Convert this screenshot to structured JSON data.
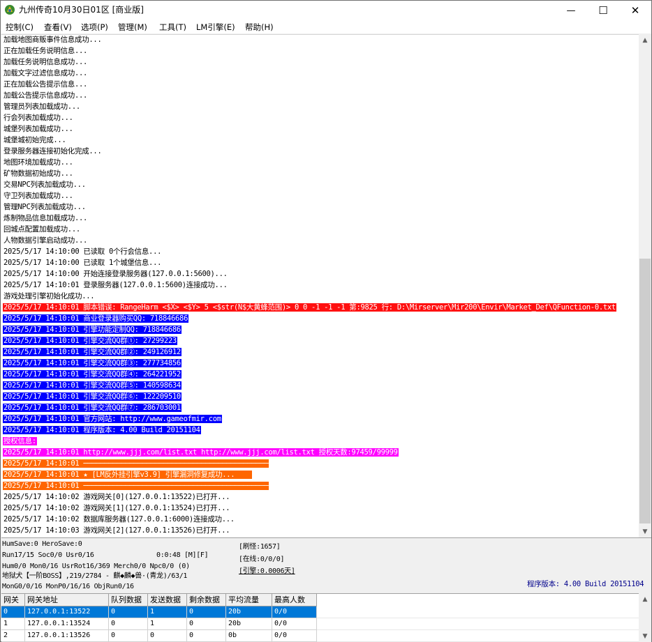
{
  "window": {
    "title": "九州传奇10月30日01区 [商业版]",
    "minimize_glyph": "—",
    "maximize_glyph": "☐",
    "close_glyph": "✕"
  },
  "menu": [
    "控制(C)",
    "查看(V)",
    "选项(P)",
    "管理(M)",
    "工具(T)",
    "LM引擎(E)",
    "帮助(H)"
  ],
  "log_lines": [
    {
      "text": "加载地图商贩事件信息成功...",
      "style": "plain"
    },
    {
      "text": "正在加载任务说明信息...",
      "style": "plain"
    },
    {
      "text": "加载任务说明信息成功...",
      "style": "plain"
    },
    {
      "text": "加载文字过滤信息成功...",
      "style": "plain"
    },
    {
      "text": "正在加载公告提示信息...",
      "style": "plain"
    },
    {
      "text": "加载公告提示信息成功...",
      "style": "plain"
    },
    {
      "text": "管理员列表加载成功...",
      "style": "plain"
    },
    {
      "text": "行会列表加载成功...",
      "style": "plain"
    },
    {
      "text": "城堡列表加载成功...",
      "style": "plain"
    },
    {
      "text": "城堡城初始完成...",
      "style": "plain"
    },
    {
      "text": "登录服务器连接初始化完成...",
      "style": "plain"
    },
    {
      "text": "地图环境加载成功...",
      "style": "plain"
    },
    {
      "text": "矿物数据初始成功...",
      "style": "plain"
    },
    {
      "text": "交易NPC列表加载成功...",
      "style": "plain"
    },
    {
      "text": "守卫列表加载成功...",
      "style": "plain"
    },
    {
      "text": "管理NPC列表加载成功...",
      "style": "plain"
    },
    {
      "text": "炼制物品信息加载成功...",
      "style": "plain"
    },
    {
      "text": "回城点配置加载成功...",
      "style": "plain"
    },
    {
      "text": "人物数据引擎启动成功...",
      "style": "plain"
    },
    {
      "text": "2025/5/17 14:10:00 已读取 0个行会信息...",
      "style": "plain"
    },
    {
      "text": "2025/5/17 14:10:00 已读取 1个城堡信息...",
      "style": "plain"
    },
    {
      "text": "2025/5/17 14:10:00 开始连接登录服务器(127.0.0.1:5600)...",
      "style": "plain"
    },
    {
      "text": "2025/5/17 14:10:01 登录服务器(127.0.0.1:5600)连接成功...",
      "style": "plain"
    },
    {
      "text": "游戏处理引擎初始化成功...",
      "style": "plain"
    },
    {
      "text": "2025/5/17 14:10:01 脚本错误: RangeHarm <$X> <$Y> 5 <$str(N$大黄蜂范围)> 0 0 -1 -1 -1 第:9825 行: D:\\Mirserver\\Mir200\\Envir\\Market_Def\\QFunction-0.txt",
      "style": "red"
    },
    {
      "text": "2025/5/17 14:10:01 商业登录器购买QQ: 718846686",
      "style": "blue"
    },
    {
      "text": "2025/5/17 14:10:01 引擎功能定制QQ: 718846686",
      "style": "blue"
    },
    {
      "text": "2025/5/17 14:10:01 引擎交流QQ群①: 27299223",
      "style": "blue"
    },
    {
      "text": "2025/5/17 14:10:01 引擎交流QQ群②: 249126912",
      "style": "blue"
    },
    {
      "text": "2025/5/17 14:10:01 引擎交流QQ群③: 277734856",
      "style": "blue"
    },
    {
      "text": "2025/5/17 14:10:01 引擎交流QQ群④: 264221952",
      "style": "blue"
    },
    {
      "text": "2025/5/17 14:10:01 引擎交流QQ群⑤: 140598634",
      "style": "blue"
    },
    {
      "text": "2025/5/17 14:10:01 引擎交流QQ群⑥: 122209510",
      "style": "blue"
    },
    {
      "text": "2025/5/17 14:10:01 引擎交流QQ群⑦: 286703001",
      "style": "blue"
    },
    {
      "text": "2025/5/17 14:10:01 官方网站: http://www.gameofmir.com",
      "style": "blue"
    },
    {
      "text": "2025/5/17 14:10:01 程序版本: 4.00 Build 20151104",
      "style": "blue"
    },
    {
      "text": "授权信息:",
      "style": "magenta"
    },
    {
      "text": "2025/5/17 14:10:01 http://www.jjj.com/list.txt http://www.jjj.com/list.txt 授权天数:97459/99999",
      "style": "magenta"
    },
    {
      "text": "2025/5/17 14:10:01 ────────────────────────────────────────────",
      "style": "orange"
    },
    {
      "text": "2025/5/17 14:10:01 ★ [LM反外挂引擎v3.9] 引擎漏洞修复成功...    ",
      "style": "orange"
    },
    {
      "text": "2025/5/17 14:10:01 ────────────────────────────────────────────",
      "style": "orange"
    },
    {
      "text": "2025/5/17 14:10:02 游戏网关[0](127.0.0.1:13522)已打开...",
      "style": "plain"
    },
    {
      "text": "2025/5/17 14:10:02 游戏网关[1](127.0.0.1:13524)已打开...",
      "style": "plain"
    },
    {
      "text": "2025/5/17 14:10:02 数据库服务器(127.0.0.1:6000)连接成功...",
      "style": "plain"
    },
    {
      "text": "2025/5/17 14:10:03 游戏网关[2](127.0.0.1:13526)已打开...",
      "style": "plain"
    }
  ],
  "log_colors": {
    "red": "#ff1010",
    "blue": "#0000ff",
    "magenta": "#ff00ff",
    "orange": "#ff6600",
    "highlight_text": "#ffffff"
  },
  "status": {
    "hum_save": "HumSave:0 HeroSave:0",
    "run": "Run17/15 Soc0/0 Usr0/16",
    "timer": "0:0:48 [M][F]",
    "hum": "Hum0/0 Mon0/16 UsrRot16/369 Merch0/0 Npc0/0 (0)",
    "boss": "地狱犬【一阶BOSS】,219/2784 - 麒◆麟◆兽·(青龙)/63/1",
    "mon": "MonG0/0/16 MonP0/16/16 ObjRun0/16",
    "refresh": "[刷怪:1657]",
    "online": "[在线:0/0/0]",
    "engine": "[引擎:0.0006天]",
    "version": "程序版本: 4.00 Build 20151104"
  },
  "gate_table": {
    "headers": [
      "网关",
      "网关地址",
      "队列数据",
      "发送数据",
      "剩余数据",
      "平均流量",
      "最高人数"
    ],
    "rows": [
      [
        "0",
        "127.0.0.1:13522",
        "0",
        "1",
        "0",
        "20b",
        "0/0"
      ],
      [
        "1",
        "127.0.0.1:13524",
        "0",
        "1",
        "0",
        "20b",
        "0/0"
      ],
      [
        "2",
        "127.0.0.1:13526",
        "0",
        "0",
        "0",
        "0b",
        "0/0"
      ]
    ],
    "selected_row": 0
  }
}
